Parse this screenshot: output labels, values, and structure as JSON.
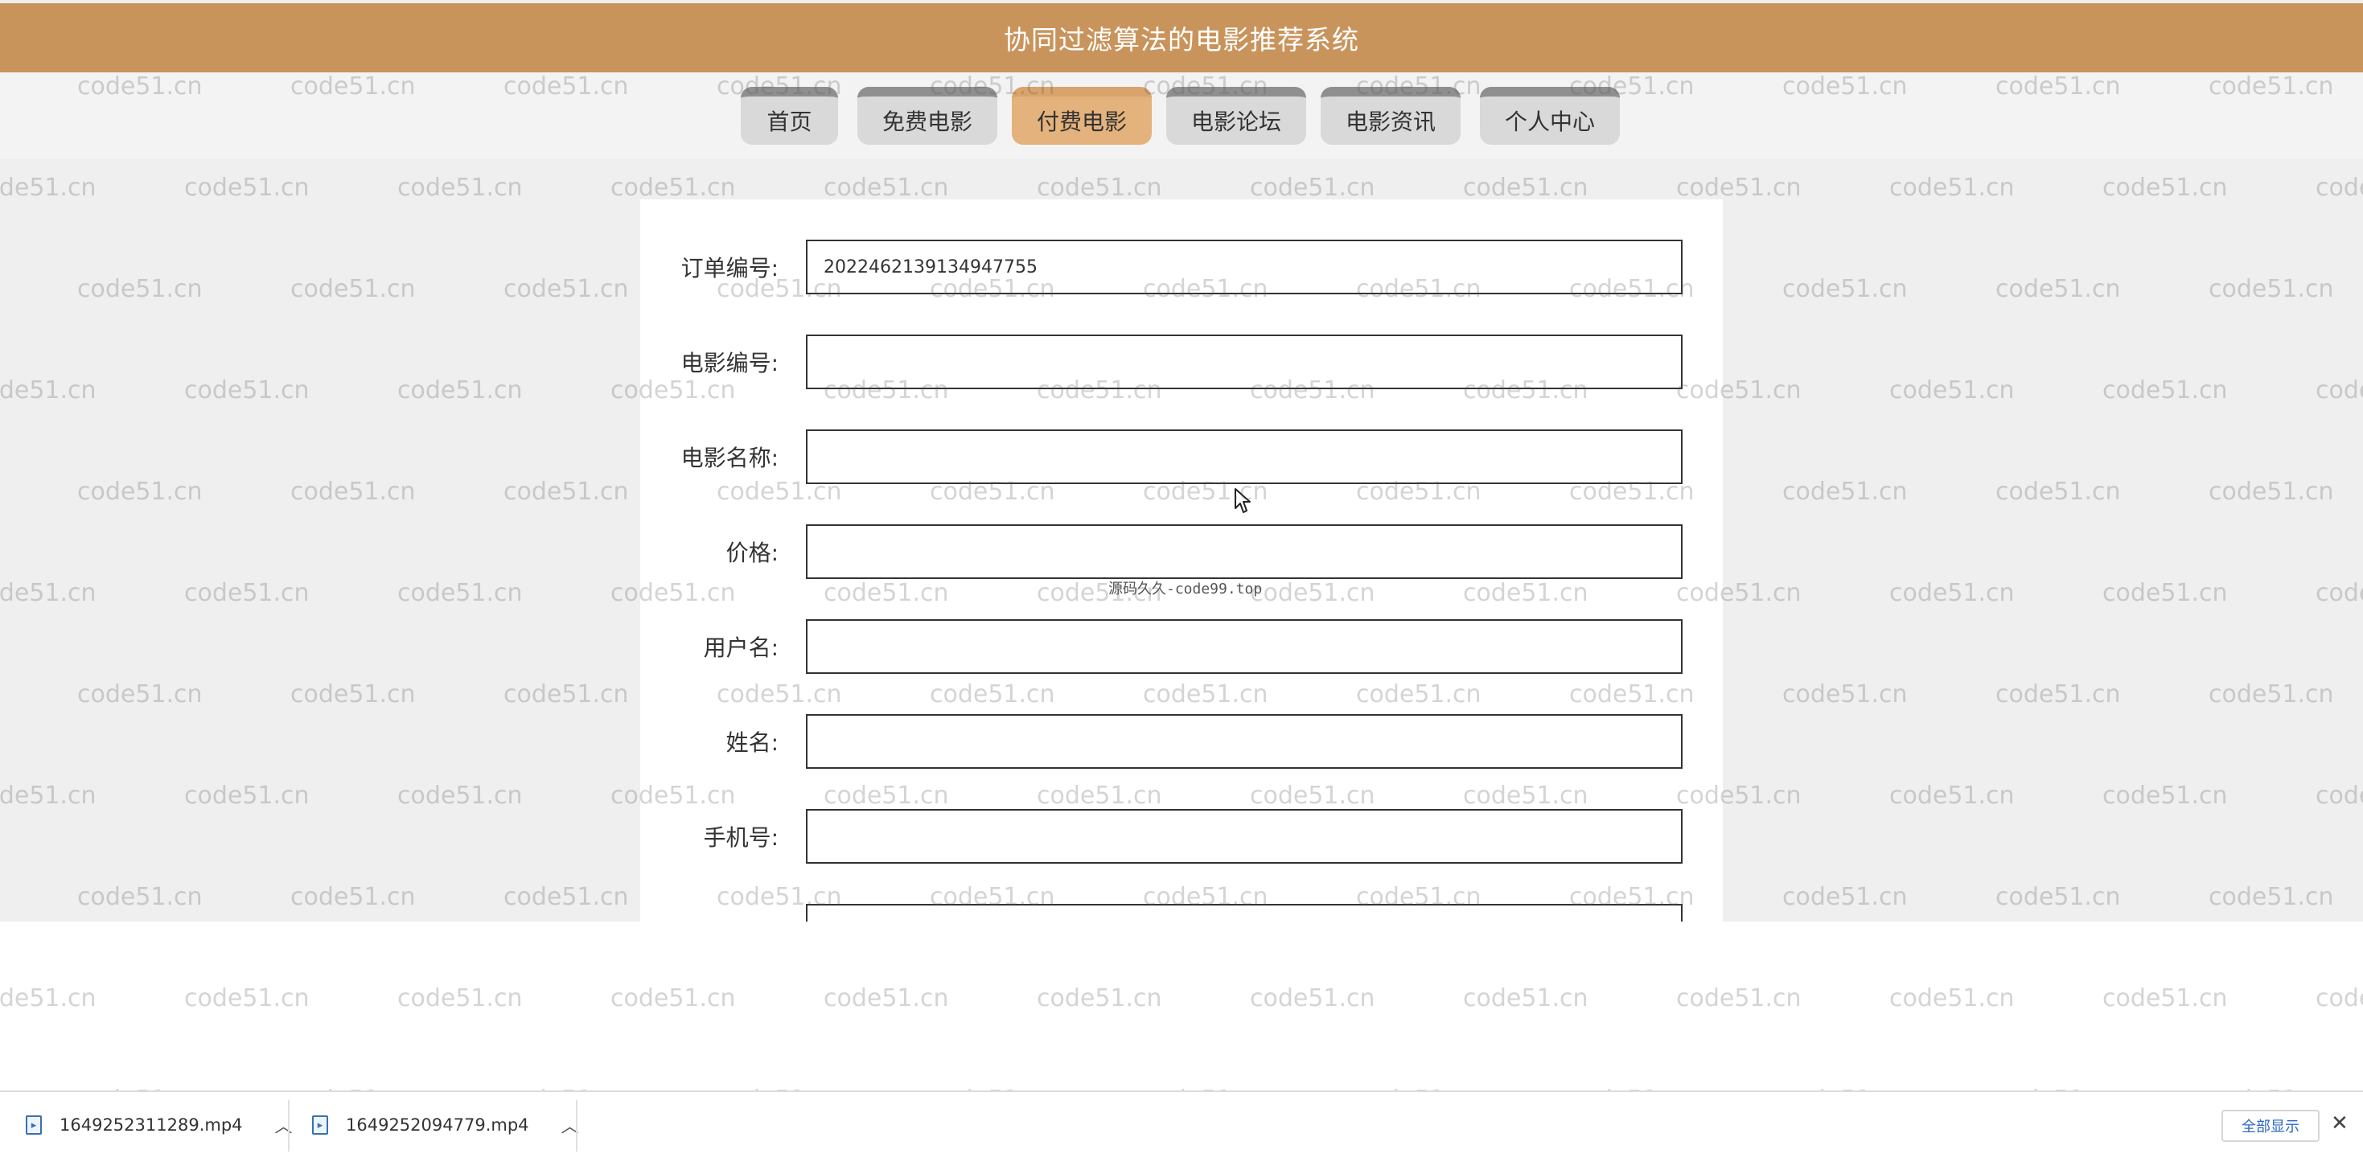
{
  "header": {
    "title": "协同过滤算法的电影推荐系统"
  },
  "nav": {
    "tabs": [
      {
        "label": "首页"
      },
      {
        "label": "免费电影"
      },
      {
        "label": "付费电影"
      },
      {
        "label": "电影论坛"
      },
      {
        "label": "电影资讯"
      },
      {
        "label": "个人中心"
      }
    ],
    "active": "付费电影",
    "active_color": "#e4b27c"
  },
  "form": {
    "fields": [
      {
        "label": "订单编号:",
        "value": "2022462139134947755"
      },
      {
        "label": "电影编号:",
        "value": ""
      },
      {
        "label": "电影名称:",
        "value": ""
      },
      {
        "label": "价格:",
        "value": ""
      },
      {
        "label": "用户名:",
        "value": ""
      },
      {
        "label": "姓名:",
        "value": ""
      },
      {
        "label": "手机号:",
        "value": ""
      }
    ]
  },
  "overlay_text": "源码久久-code99.top",
  "watermark": {
    "text": "code51.cn"
  },
  "downloads": {
    "items": [
      {
        "name": "1649252311289.mp4"
      },
      {
        "name": "1649252094779.mp4"
      }
    ],
    "show_all": "全部显示",
    "close": "✕"
  },
  "colors": {
    "header": "#c9945c",
    "nav_active": "#e4b27c",
    "nav_inactive": "#d9d9d9"
  }
}
